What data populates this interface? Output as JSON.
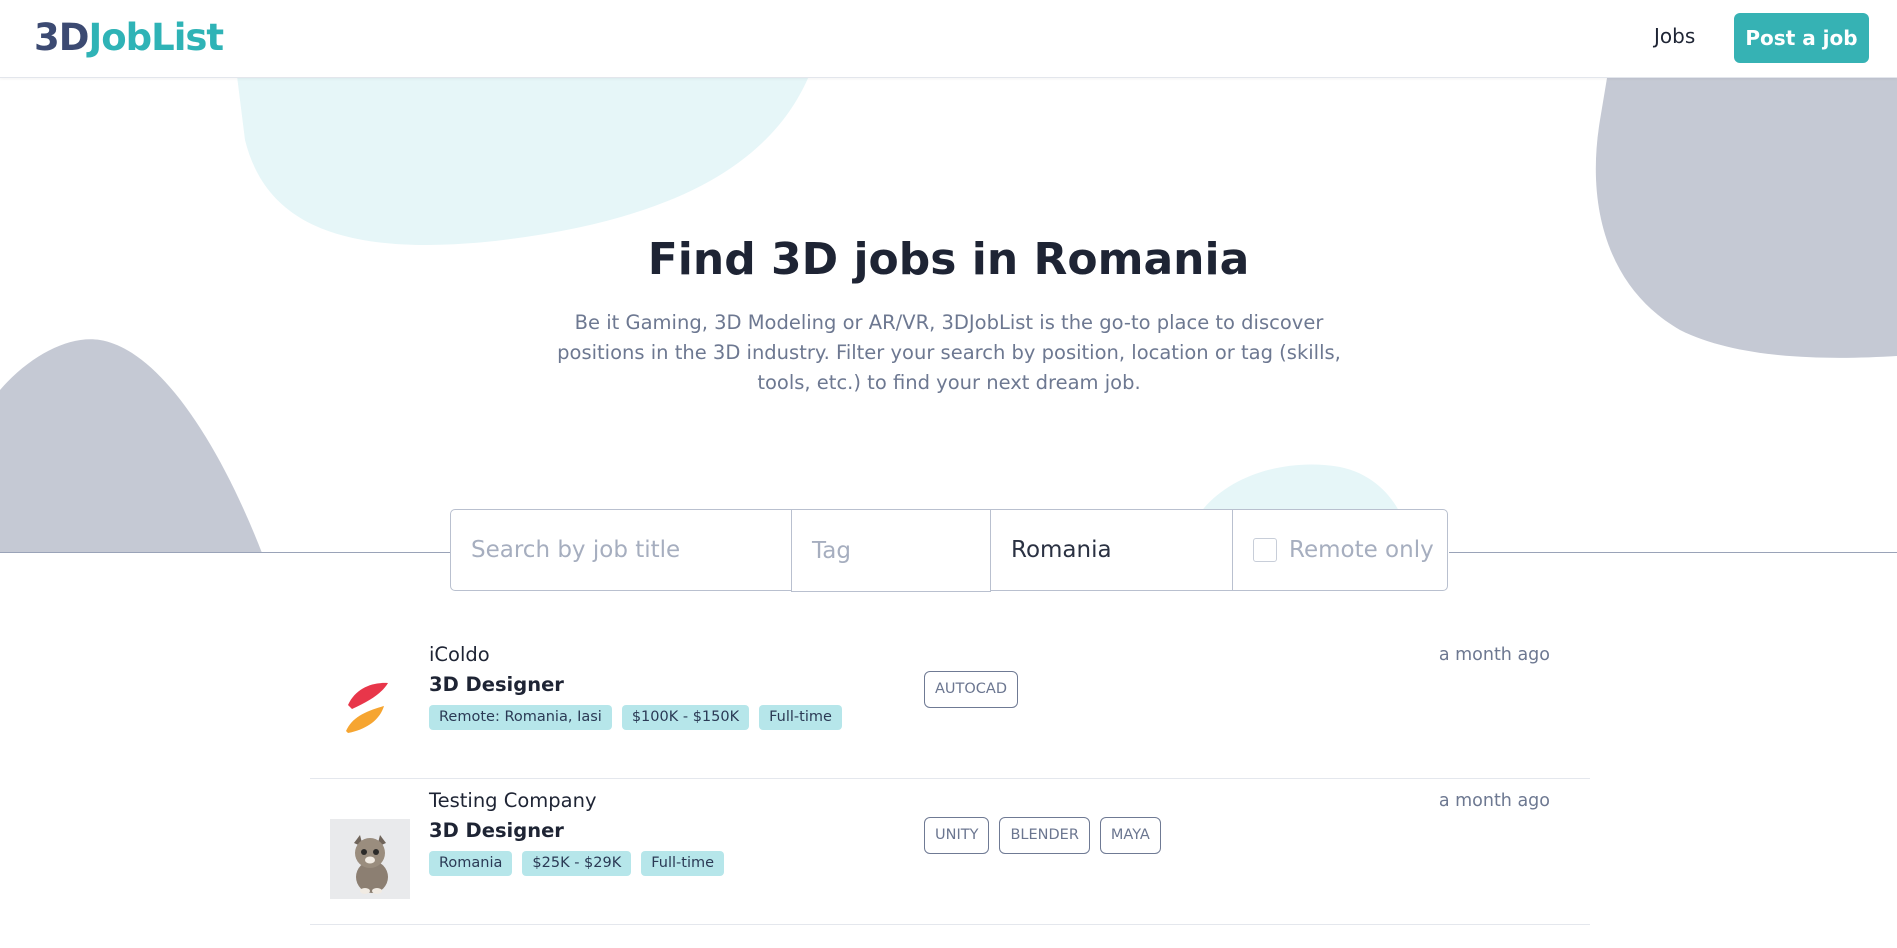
{
  "header": {
    "logo_part1": "3D",
    "logo_part2": "JobList",
    "nav_jobs": "Jobs",
    "post_job": "Post a job"
  },
  "hero": {
    "title": "Find 3D jobs in Romania",
    "description": "Be it Gaming, 3D Modeling or AR/VR, 3DJobList is the go-to place to discover positions in the 3D industry. Filter your search by position, location or tag (skills, tools, etc.) to find your next dream job."
  },
  "search": {
    "job_title_placeholder": "Search by job title",
    "tag_placeholder": "Tag",
    "location_value": "Romania",
    "remote_label": "Remote only"
  },
  "jobs": [
    {
      "company": "iColdo",
      "title": "3D Designer",
      "chips": [
        "Remote: Romania, Iasi",
        "$100K - $150K",
        "Full-time"
      ],
      "tags": [
        "AUTOCAD"
      ],
      "posted": "a month ago"
    },
    {
      "company": "Testing Company",
      "title": "3D Designer",
      "chips": [
        "Romania",
        "$25K - $29K",
        "Full-time"
      ],
      "tags": [
        "UNITY",
        "BLENDER",
        "MAYA"
      ],
      "posted": "a month ago"
    }
  ],
  "colors": {
    "brand_teal": "#36b2b4",
    "logo_dark": "#3c4a72",
    "chip_bg": "#b6e6ea",
    "blob_gray": "#c5c9d4",
    "blob_cyan": "#e6f6f8"
  }
}
